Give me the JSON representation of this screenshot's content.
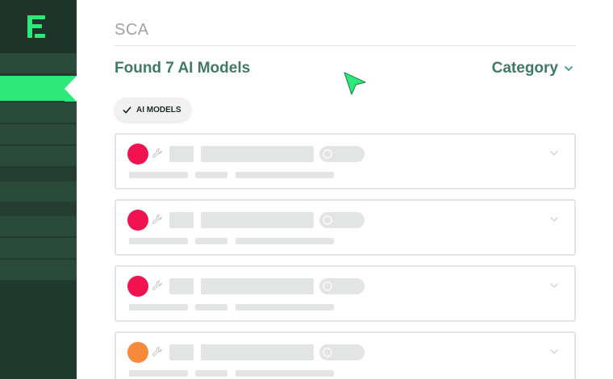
{
  "sidebar": {
    "logo": "escape-logo",
    "active_index": 1
  },
  "main": {
    "section_title": "SCA",
    "found_text": "Found 7 AI Models",
    "category_label": "Category",
    "filter_chip": {
      "label": "AI MODELS",
      "checked": true
    }
  },
  "cards": [
    {
      "severity_color": "#f0134f"
    },
    {
      "severity_color": "#f0134f"
    },
    {
      "severity_color": "#f0134f"
    },
    {
      "severity_color": "#f58a3a"
    }
  ],
  "colors": {
    "sidebar_bg": "#1f3a2e",
    "accent_green": "#2ee87a",
    "heading_green": "#3f7a64",
    "critical": "#f0134f",
    "high": "#f58a3a"
  }
}
